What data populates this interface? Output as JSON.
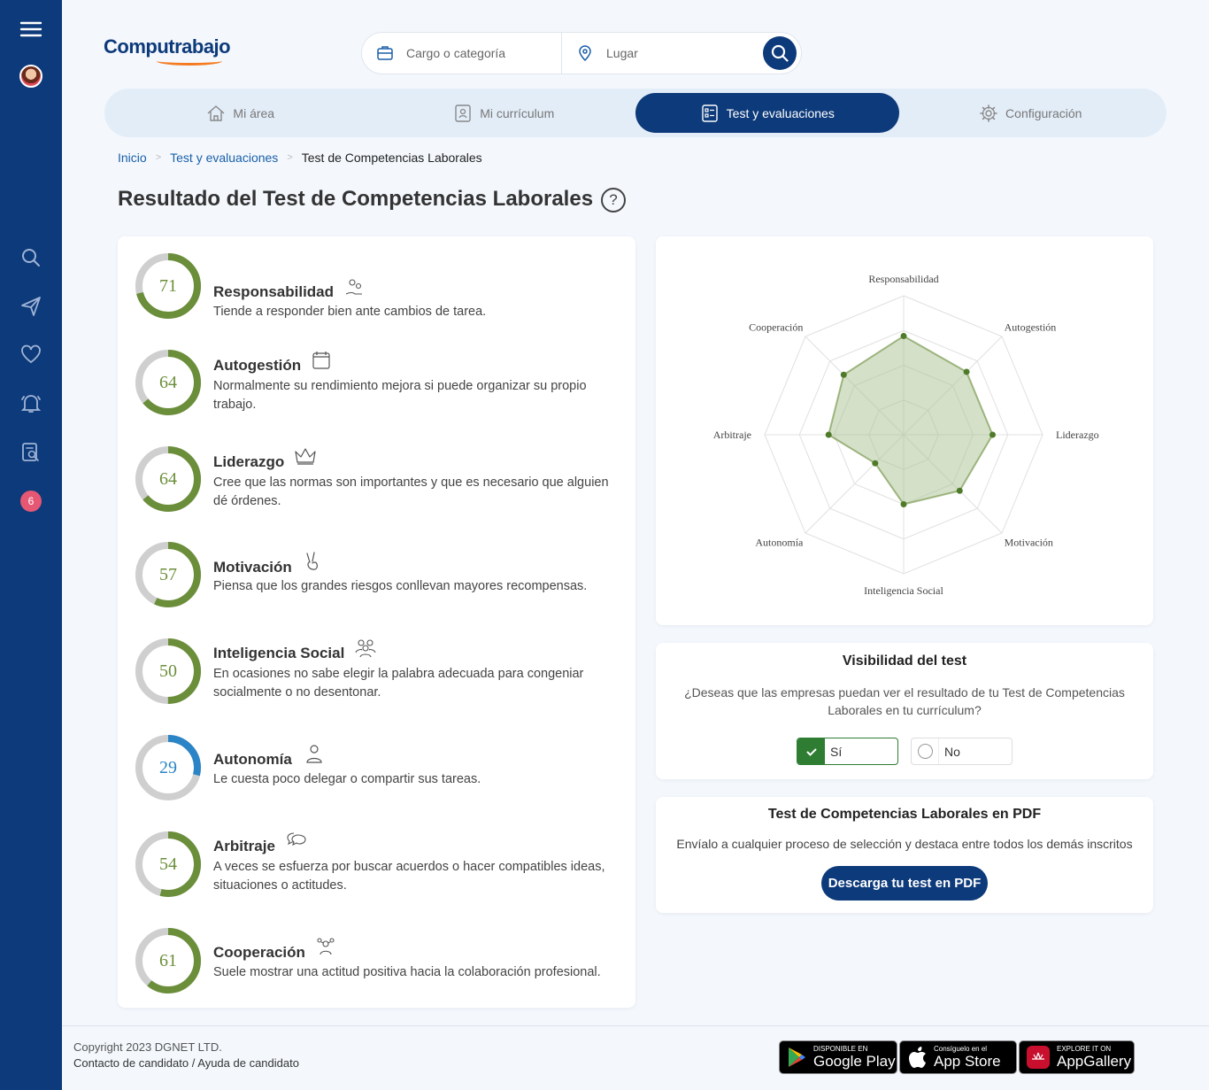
{
  "sidebar": {
    "badge_count": "6"
  },
  "header": {
    "logo_text": "Computrabajo",
    "search_placeholder": "Cargo o categoría",
    "location_placeholder": "Lugar"
  },
  "tabs": [
    {
      "label": "Mi área",
      "icon": "home-icon"
    },
    {
      "label": "Mi currículum",
      "icon": "resume-icon"
    },
    {
      "label": "Test y evaluaciones",
      "icon": "test-icon",
      "active": true
    },
    {
      "label": "Configuración",
      "icon": "gear-icon"
    }
  ],
  "breadcrumb": {
    "home": "Inicio",
    "section": "Test y evaluaciones",
    "current": "Test de Competencias Laborales"
  },
  "page_title": "Resultado del Test de Competencias Laborales",
  "help_symbol": "?",
  "competencies": [
    {
      "name": "Responsabilidad",
      "score": 71,
      "desc": "Tiende a responder bien ante cambios de tarea.",
      "color": "#6b8e3a",
      "icon": "gears-hand-icon"
    },
    {
      "name": "Autogestión",
      "score": 64,
      "desc": "Normalmente su rendimiento mejora si puede organizar su propio trabajo.",
      "color": "#6b8e3a",
      "icon": "calendar-icon"
    },
    {
      "name": "Liderazgo",
      "score": 64,
      "desc": "Cree que las normas son importantes y que es necesario que alguien dé órdenes.",
      "color": "#6b8e3a",
      "icon": "crown-icon"
    },
    {
      "name": "Motivación",
      "score": 57,
      "desc": "Piensa que los grandes riesgos conllevan mayores recompensas.",
      "color": "#6b8e3a",
      "icon": "victory-hand-icon"
    },
    {
      "name": "Inteligencia Social",
      "score": 50,
      "desc": "En ocasiones no sabe elegir la palabra adecuada para congeniar socialmente o no desentonar.",
      "color": "#6b8e3a",
      "icon": "group-icon"
    },
    {
      "name": "Autonomía",
      "score": 29,
      "desc": "Le cuesta poco delegar o compartir sus tareas.",
      "color": "#2a84c6",
      "icon": "person-icon"
    },
    {
      "name": "Arbitraje",
      "score": 54,
      "desc": "A veces se esfuerza por buscar acuerdos o hacer compatibles ideas, situaciones o actitudes.",
      "color": "#6b8e3a",
      "icon": "chat-bubbles-icon"
    },
    {
      "name": "Cooperación",
      "score": 61,
      "desc": "Suele mostrar una actitud positiva hacia la colaboración profesional.",
      "color": "#6b8e3a",
      "icon": "team-icon"
    }
  ],
  "chart_data": {
    "type": "radar",
    "categories": [
      "Responsabilidad",
      "Autogestión",
      "Liderazgo",
      "Motivación",
      "Inteligencia Social",
      "Autonomía",
      "Arbitraje",
      "Cooperación"
    ],
    "values": [
      71,
      64,
      64,
      57,
      50,
      29,
      54,
      61
    ],
    "range": [
      0,
      100
    ],
    "fill_color": "#a9c191",
    "line_color": "#6b8e3a",
    "point_color": "#4f7a2a",
    "grid_color": "#e0e0e0"
  },
  "visibility": {
    "title": "Visibilidad del test",
    "question": "¿Deseas que las empresas puedan ver el resultado de tu Test de Competencias Laborales en tu currículum?",
    "yes_label": "Sí",
    "no_label": "No",
    "selected": "yes"
  },
  "pdf": {
    "title": "Test de Competencias Laborales en PDF",
    "desc": "Envíalo a cualquier proceso de selección y destaca entre todos los demás inscritos",
    "button": "Descarga tu test en PDF"
  },
  "footer": {
    "copyright": "Copyright 2023 DGNET LTD.",
    "contact": "Contacto de candidato",
    "separator": "/",
    "help": "Ayuda de candidato",
    "stores": [
      {
        "small": "DISPONIBLE EN",
        "big": "Google Play"
      },
      {
        "small": "Consíguelo en el",
        "big": "App Store"
      },
      {
        "small": "EXPLORE IT ON",
        "big": "AppGallery"
      }
    ]
  }
}
